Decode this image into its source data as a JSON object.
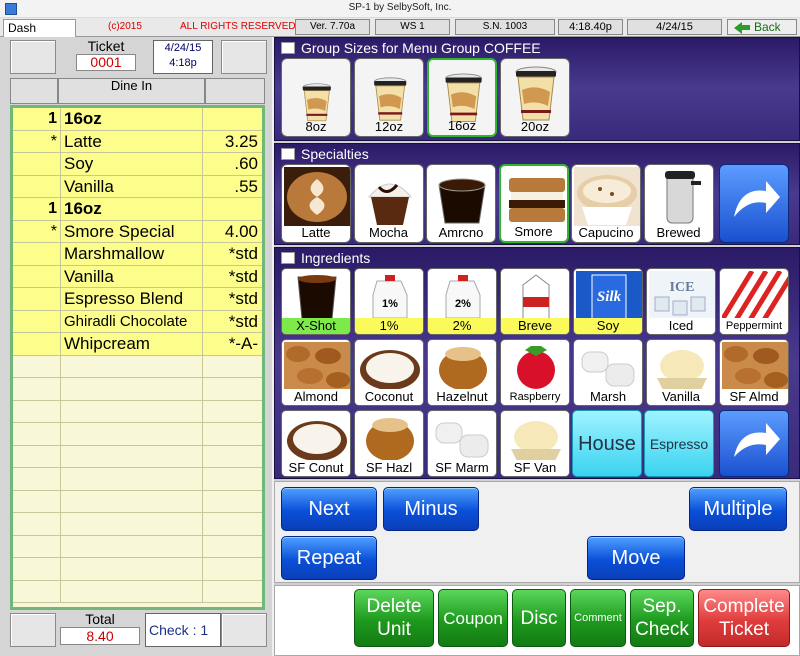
{
  "window": {
    "title": "SP-1 by SelbySoft, Inc."
  },
  "statusbar": {
    "tab": "Dash Board",
    "copyright": "(c)2015",
    "rights": "ALL RIGHTS RESERVED",
    "version": "Ver. 7.70a",
    "ws": "WS  1",
    "sn": "S.N. 1003",
    "time": "4:18.40p",
    "date": "4/24/15",
    "back": "Back"
  },
  "ticket": {
    "label": "Ticket",
    "number": "0001",
    "date": "4/24/15",
    "time": "4:18p",
    "type": "Dine In"
  },
  "order_lines": [
    {
      "qty": "1",
      "item": "16oz",
      "price": "",
      "bold": true
    },
    {
      "qty": "*",
      "item": "Latte",
      "price": "3.25",
      "bold": false
    },
    {
      "qty": "",
      "item": "Soy",
      "price": ".60",
      "bold": false
    },
    {
      "qty": "",
      "item": "Vanilla",
      "price": ".55",
      "bold": false
    },
    {
      "qty": "1",
      "item": "16oz",
      "price": "",
      "bold": true
    },
    {
      "qty": "*",
      "item": "Smore Special",
      "price": "4.00",
      "bold": false
    },
    {
      "qty": "",
      "item": "Marshmallow",
      "price": "*std",
      "bold": false
    },
    {
      "qty": "",
      "item": "Vanilla",
      "price": "*std",
      "bold": false
    },
    {
      "qty": "",
      "item": "Espresso Blend",
      "price": "*std",
      "bold": false
    },
    {
      "qty": "",
      "item": "Ghiradli Chocolate",
      "price": "*std",
      "bold": false
    },
    {
      "qty": "",
      "item": "Whipcream",
      "price": "*-A-",
      "bold": false
    }
  ],
  "footer": {
    "total_label": "Total",
    "total_value": "8.40",
    "check": "Check : 1"
  },
  "group_sizes": {
    "title": "Group Sizes for Menu Group COFFEE",
    "items": [
      {
        "label": "8oz"
      },
      {
        "label": "12oz"
      },
      {
        "label": "16oz",
        "selected": true
      },
      {
        "label": "20oz"
      }
    ]
  },
  "specialties": {
    "title": "Specialties",
    "items": [
      {
        "label": "Latte",
        "icon": "latte-icon"
      },
      {
        "label": "Mocha",
        "icon": "mocha-icon"
      },
      {
        "label": "Amrcno",
        "icon": "americano-icon"
      },
      {
        "label": "Smore",
        "icon": "smore-icon",
        "selected": true
      },
      {
        "label": "Capucino",
        "icon": "cappuccino-icon"
      },
      {
        "label": "Brewed",
        "icon": "brewed-icon"
      }
    ]
  },
  "ingredients": {
    "title": "Ingredients",
    "items": [
      {
        "label": "X-Shot",
        "icon": "espresso-icon",
        "highlight": "green"
      },
      {
        "label": "1%",
        "icon": "milk-jug-icon",
        "milk_label": "1%",
        "highlight": "yellow"
      },
      {
        "label": "2%",
        "icon": "milk-jug-icon",
        "milk_label": "2%",
        "highlight": "yellow"
      },
      {
        "label": "Breve",
        "icon": "milk-carton-icon",
        "highlight": "yellow"
      },
      {
        "label": "Soy",
        "icon": "soy-milk-icon",
        "carton_text": "Silk",
        "highlight": "yellow"
      },
      {
        "label": "Iced",
        "icon": "ice-icon",
        "ice_text": "ICE",
        "highlight": "none"
      },
      {
        "label": "Peppermint",
        "icon": "peppermint-icon",
        "highlight": "none"
      },
      {
        "label": "Almond",
        "icon": "almond-icon",
        "highlight": "none"
      },
      {
        "label": "Coconut",
        "icon": "coconut-icon",
        "highlight": "none"
      },
      {
        "label": "Hazelnut",
        "icon": "hazelnut-icon",
        "highlight": "none"
      },
      {
        "label": "Raspberry",
        "icon": "raspberry-icon",
        "highlight": "none"
      },
      {
        "label": "Marsh",
        "icon": "marshmallow-icon",
        "highlight": "none"
      },
      {
        "label": "Vanilla",
        "icon": "vanilla-icon",
        "highlight": "none"
      },
      {
        "label": "SF Almd",
        "icon": "almond-icon",
        "highlight": "none"
      },
      {
        "label": "SF Conut",
        "icon": "coconut-icon",
        "highlight": "none"
      },
      {
        "label": "SF Hazl",
        "icon": "hazelnut-icon",
        "highlight": "none"
      },
      {
        "label": "SF Marm",
        "icon": "marshmallow-icon",
        "highlight": "none"
      },
      {
        "label": "SF Van",
        "icon": "vanilla-icon",
        "highlight": "none"
      }
    ],
    "house": "House",
    "espresso": "Espresso"
  },
  "actions": {
    "next": "Next",
    "minus": "Minus",
    "multiple": "Multiple",
    "repeat": "Repeat",
    "move": "Move"
  },
  "bottom": {
    "delete_line1": "Delete",
    "delete_line2": "Unit",
    "coupon": "Coupon",
    "disc": "Disc",
    "comment": "Comment",
    "sep_line1": "Sep.",
    "sep_line2": "Check",
    "complete_line1": "Complete",
    "complete_line2": "Ticket"
  },
  "colors": {
    "accent_green": "#2fb52f",
    "blue_button": "#0a4fd8",
    "section_purple": "#3a2a7a",
    "order_highlight": "#fdfd8c",
    "total_red": "#cc0000"
  }
}
